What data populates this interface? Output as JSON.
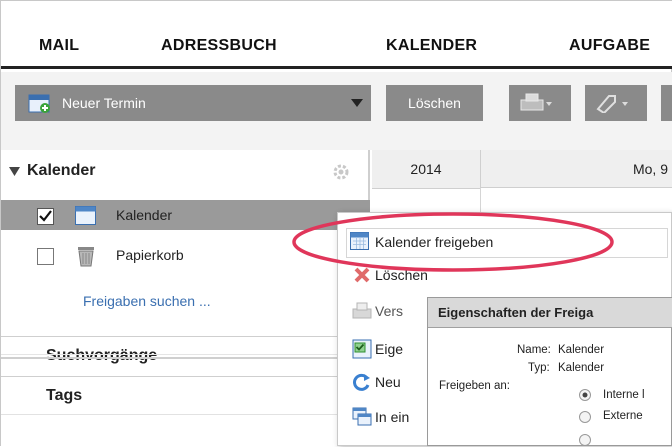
{
  "nav": {
    "mail": "MAIL",
    "adressbuch": "ADRESSBUCH",
    "kalender": "KALENDER",
    "aufgaben": "AUFGABE"
  },
  "toolbar": {
    "new_event": "Neuer Termin",
    "delete": "Löschen"
  },
  "sidebar": {
    "kalender_header": "Kalender",
    "items": [
      {
        "label": "Kalender",
        "checked": true
      },
      {
        "label": "Papierkorb",
        "checked": false
      }
    ],
    "find_shares": "Freigaben suchen ...",
    "searches": "Suchvorgänge",
    "tags": "Tags"
  },
  "grid": {
    "year": "2014",
    "day": "Mo, 9"
  },
  "context_menu": {
    "items": [
      "Kalender freigeben",
      "Löschen",
      "Vers",
      "Eige",
      "Neu",
      "In ein"
    ]
  },
  "dialog": {
    "title": "Eigenschaften der Freiga",
    "name_label": "Name:",
    "name_value": "Kalender",
    "type_label": "Typ:",
    "type_value": "Kalender",
    "share_label": "Freigeben an:",
    "options": [
      "Interne l",
      "Externe"
    ]
  },
  "colors": {
    "highlight": "#e0365a",
    "toolbar_button": "#8a8a8a",
    "selected_row": "#9a9a9a"
  }
}
